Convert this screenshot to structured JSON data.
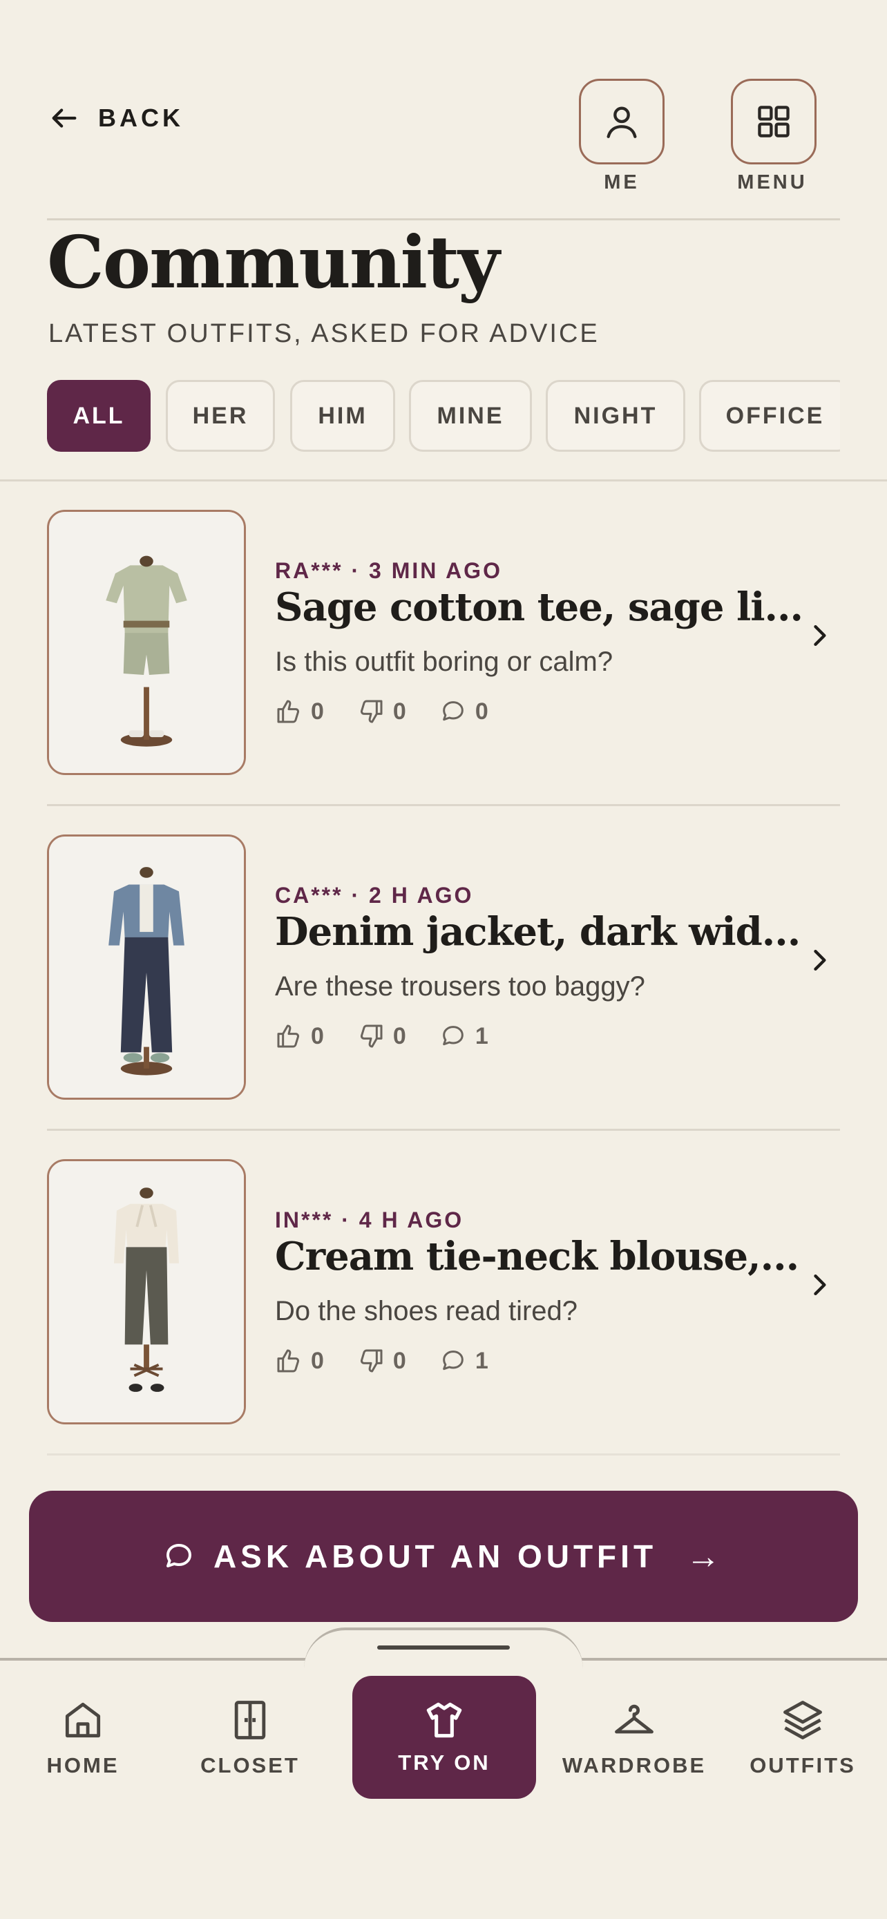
{
  "header": {
    "back_label": "BACK",
    "me_label": "ME",
    "menu_label": "MENU"
  },
  "page": {
    "title": "Community",
    "subtitle": "LATEST OUTFITS, ASKED FOR ADVICE"
  },
  "filters": [
    {
      "label": "ALL",
      "active": true
    },
    {
      "label": "HER",
      "active": false
    },
    {
      "label": "HIM",
      "active": false
    },
    {
      "label": "MINE",
      "active": false
    },
    {
      "label": "NIGHT",
      "active": false
    },
    {
      "label": "OFFICE",
      "active": false
    }
  ],
  "posts": [
    {
      "meta": "RA*** · 3 MIN AGO",
      "title": "Sage cotton tee, sage li...",
      "question": "Is this outfit boring or calm?",
      "likes": "0",
      "dislikes": "0",
      "comments": "0"
    },
    {
      "meta": "CA*** · 2 H AGO",
      "title": "Denim jacket, dark wid...",
      "question": "Are these trousers too baggy?",
      "likes": "0",
      "dislikes": "0",
      "comments": "1"
    },
    {
      "meta": "IN*** · 4 H AGO",
      "title": "Cream tie-neck blouse,...",
      "question": "Do the shoes read tired?",
      "likes": "0",
      "dislikes": "0",
      "comments": "1"
    }
  ],
  "ask_button": {
    "label": "ASK ABOUT AN OUTFIT",
    "arrow": "→"
  },
  "bottom_nav": [
    {
      "label": "HOME",
      "icon": "home-icon"
    },
    {
      "label": "CLOSET",
      "icon": "closet-icon"
    },
    {
      "label": "TRY ON",
      "icon": "shirt-icon",
      "active": true
    },
    {
      "label": "WARDROBE",
      "icon": "hanger-icon"
    },
    {
      "label": "OUTFITS",
      "icon": "layers-icon"
    }
  ],
  "colors": {
    "accent": "#5f2748",
    "background": "#f3efe5",
    "border": "#9a6b58"
  }
}
